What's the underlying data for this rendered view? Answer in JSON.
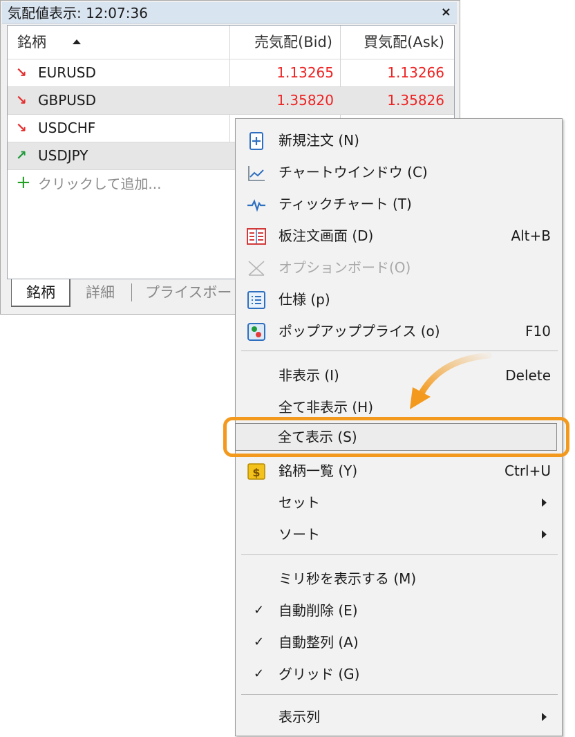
{
  "market_watch": {
    "title": "気配値表示: 12:07:36",
    "close_glyph": "×",
    "columns": {
      "symbol": "銘柄",
      "bid": "売気配(Bid)",
      "ask": "買気配(Ask)"
    },
    "rows": [
      {
        "arrow": "↘",
        "direction": "down",
        "symbol": "EURUSD",
        "bid": "1.13265",
        "ask": "1.13266"
      },
      {
        "arrow": "↘",
        "direction": "down",
        "symbol": "GBPUSD",
        "bid": "1.35820",
        "ask": "1.35826"
      },
      {
        "arrow": "↘",
        "direction": "down",
        "symbol": "USDCHF",
        "bid": "",
        "ask": ""
      },
      {
        "arrow": "↗",
        "direction": "up",
        "symbol": "USDJPY",
        "bid": "",
        "ask": ""
      }
    ],
    "add_row": {
      "plus": "+",
      "label": "クリックして追加..."
    },
    "tabs": [
      "銘柄",
      "詳細",
      "プライスボード"
    ]
  },
  "context_menu": {
    "items": [
      {
        "label": "新規注文 (N)",
        "shortcut": "",
        "icon": "new-order-icon"
      },
      {
        "label": "チャートウインドウ (C)",
        "shortcut": "",
        "icon": "chart-window-icon"
      },
      {
        "label": "ティックチャート (T)",
        "shortcut": "",
        "icon": "tick-chart-icon"
      },
      {
        "label": "板注文画面 (D)",
        "shortcut": "Alt+B",
        "icon": "depth-of-market-icon"
      },
      {
        "label": "オプションボード(O)",
        "shortcut": "",
        "icon": "option-board-icon",
        "disabled": true
      },
      {
        "label": "仕様 (p)",
        "shortcut": "",
        "icon": "specification-icon"
      },
      {
        "label": "ポップアッププライス (o)",
        "shortcut": "F10",
        "icon": "popup-prices-icon"
      },
      {
        "label": "非表示 (I)",
        "shortcut": "Delete"
      },
      {
        "label": "全て非表示 (H)",
        "shortcut": ""
      },
      {
        "label": "全て表示 (S)",
        "shortcut": "",
        "highlighted": true
      },
      {
        "label": "銘柄一覧 (Y)",
        "shortcut": "Ctrl+U",
        "icon": "symbols-icon"
      },
      {
        "label": "セット",
        "submenu": true
      },
      {
        "label": "ソート",
        "submenu": true
      },
      {
        "label": "ミリ秒を表示する (M)",
        "shortcut": ""
      },
      {
        "label": "自動削除 (E)",
        "checked": true
      },
      {
        "label": "自動整列 (A)",
        "checked": true
      },
      {
        "label": "グリッド (G)",
        "checked": true
      },
      {
        "label": "表示列",
        "submenu": true
      }
    ],
    "check_glyph": "✓"
  },
  "colors": {
    "price": "#ee2222",
    "down_arrow": "#e53030",
    "up_arrow": "#1f9a3a",
    "highlight": "#f39a1e",
    "title_bar": "#d9e4f1"
  }
}
